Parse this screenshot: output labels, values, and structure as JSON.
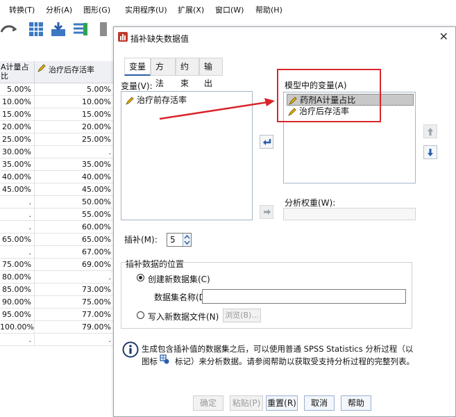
{
  "menu": [
    "转换(T)",
    "分析(A)",
    "图形(G)",
    "实用程序(U)",
    "扩展(X)",
    "窗口(W)",
    "帮助(H)"
  ],
  "sheet": {
    "col1_header": "A计量占比",
    "col2_header": "治疗后存活率",
    "rows": [
      [
        "5.00%",
        "5.00%"
      ],
      [
        "10.00%",
        "10.00%"
      ],
      [
        "15.00%",
        "15.00%"
      ],
      [
        "20.00%",
        "20.00%"
      ],
      [
        "25.00%",
        "25.00%"
      ],
      [
        "30.00%",
        "."
      ],
      [
        "35.00%",
        "35.00%"
      ],
      [
        "40.00%",
        "40.00%"
      ],
      [
        "45.00%",
        "45.00%"
      ],
      [
        ".",
        "50.00%"
      ],
      [
        ".",
        "55.00%"
      ],
      [
        ".",
        "60.00%"
      ],
      [
        "65.00%",
        "65.00%"
      ],
      [
        ".",
        "67.00%"
      ],
      [
        "75.00%",
        "69.00%"
      ],
      [
        "80.00%",
        "."
      ],
      [
        "85.00%",
        "73.00%"
      ],
      [
        "90.00%",
        "75.00%"
      ],
      [
        "95.00%",
        "77.00%"
      ],
      [
        "100.00%",
        "79.00%"
      ],
      [
        ".",
        "."
      ]
    ]
  },
  "dialog": {
    "title": "插补缺失数据值",
    "tabs": [
      "变量",
      "方法",
      "约束",
      "输出"
    ],
    "variables_label": "变量(V):",
    "variables": [
      "治疗前存活率"
    ],
    "model_label": "模型中的变量(A)",
    "model_vars": [
      "药剂A计量占比",
      "治疗后存活率"
    ],
    "weight_label": "分析权重(W):",
    "impute_label": "插补(M):",
    "impute_value": "5",
    "location_label": "插补数据的位置",
    "create_dataset": "创建新数据集(C)",
    "dataset_name": "数据集名称(D",
    "write_file": "写入新数据文件(N)",
    "browse": "浏览(B)...",
    "info_line1": "生成包含插补值的数据集之后，可以使用普通 SPSS Statistics 分析过程（以",
    "info_line2_a": "图标",
    "info_line2_b": "标记）来分析数据。请参阅帮助以获取受支持分析过程的完整列表。",
    "buttons": [
      "确定",
      "粘贴(P)",
      "重置(R)",
      "取消",
      "帮助"
    ]
  },
  "colors": {
    "accent": "#2a5ea8",
    "annotation": "#d9252b"
  }
}
